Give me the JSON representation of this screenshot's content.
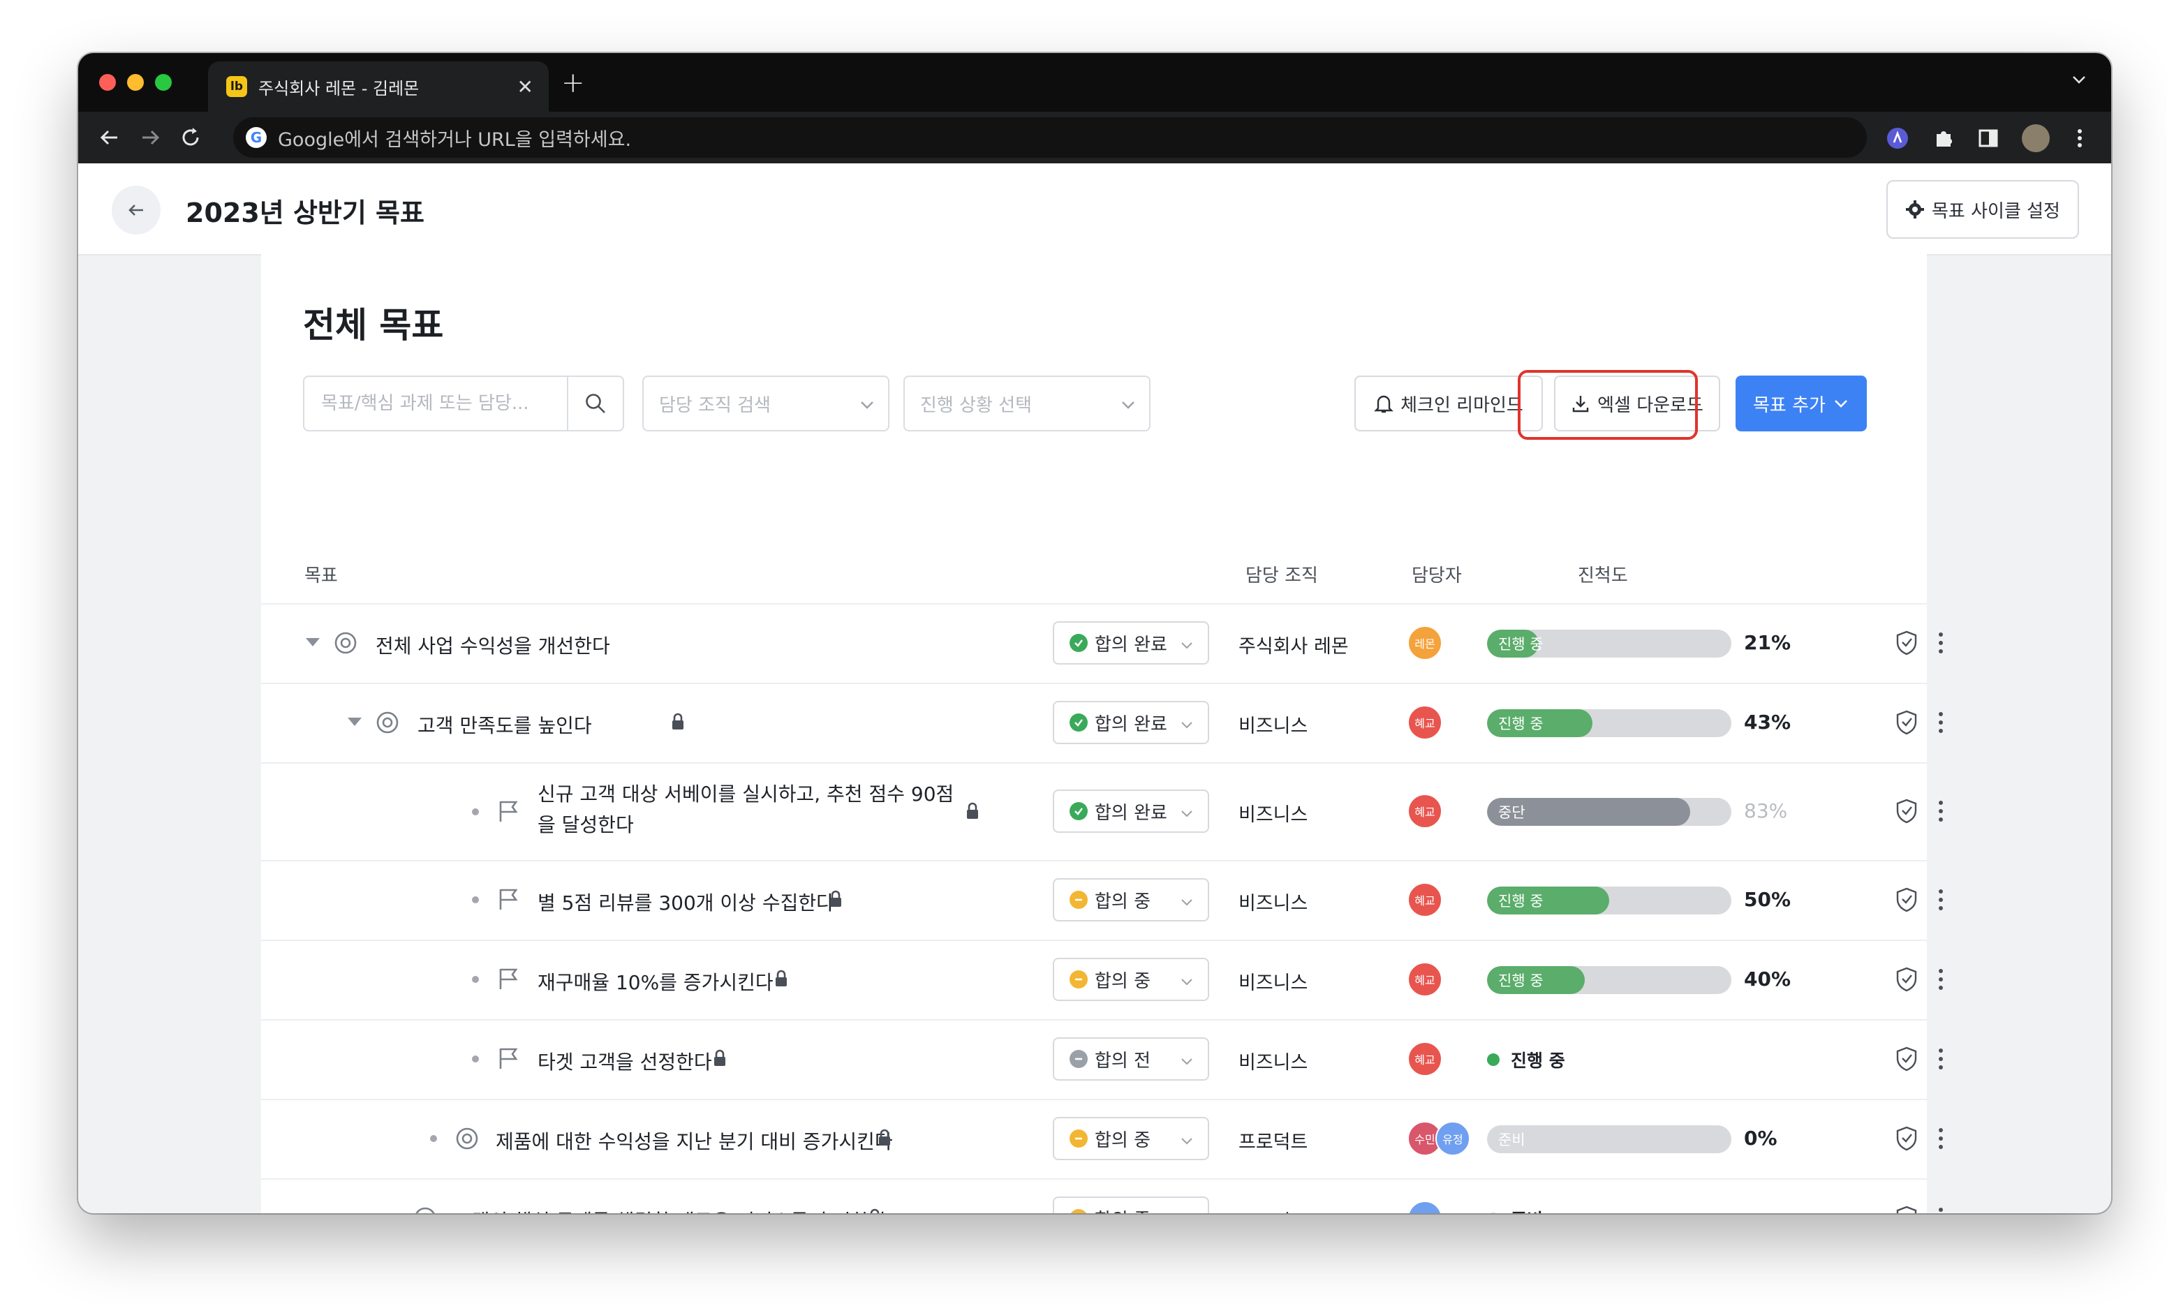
{
  "browser": {
    "tab_title": "주식회사 레몬 - 김레몬",
    "tab_favicon": "lb",
    "omnibox_placeholder": "Google에서 검색하거나 URL을 입력하세요."
  },
  "header": {
    "title": "2023년 상반기 목표",
    "cycle_button": "목표 사이클 설정"
  },
  "main": {
    "section_title": "전체 목표",
    "search_placeholder": "목표/핵심 과제 또는 담당...",
    "org_select_placeholder": "담당 조직 검색",
    "progress_select_placeholder": "진행 상황 선택",
    "remind_button": "체크인 리마인드",
    "excel_button": "엑셀 다운로드",
    "add_goal_button": "목표 추가"
  },
  "table": {
    "columns": [
      "목표",
      "담당 조직",
      "담당자",
      "진척도"
    ],
    "rows": [
      {
        "title": "전체 사업 수익성을 개선한다",
        "status": "합의 완료",
        "org": "주식회사 레몬",
        "avatars": [
          "레몬"
        ],
        "progress_label": "진행 중",
        "progress": 21,
        "pct": "21%"
      },
      {
        "title": "고객 만족도를 높인다",
        "status": "합의 완료",
        "org": "비즈니스",
        "avatars": [
          "혜교"
        ],
        "progress_label": "진행 중",
        "progress": 43,
        "pct": "43%"
      },
      {
        "title": "신규 고객 대상 서베이를 실시하고, 추천 점수 90점을 달성한다",
        "status": "합의 완료",
        "org": "비즈니스",
        "avatars": [
          "혜교"
        ],
        "progress_label": "중단",
        "progress": 83,
        "pct": "83%"
      },
      {
        "title": "별 5점 리뷰를 300개 이상 수집한다",
        "status": "합의 중",
        "org": "비즈니스",
        "avatars": [
          "혜교"
        ],
        "progress_label": "진행 중",
        "progress": 50,
        "pct": "50%"
      },
      {
        "title": "재구매율 10%를 증가시킨다",
        "status": "합의 중",
        "org": "비즈니스",
        "avatars": [
          "혜교"
        ],
        "progress_label": "진행 중",
        "progress": 40,
        "pct": "40%"
      },
      {
        "title": "타겟 고객을 선정한다",
        "status": "합의 전",
        "org": "비즈니스",
        "avatars": [
          "혜교"
        ],
        "progress_label": "진행 중"
      },
      {
        "title": "제품에 대한 수익성을 지난 분기 대비 증가시킨다",
        "status": "합의 중",
        "org": "프로덕트",
        "avatars": [
          "수민",
          "유정"
        ],
        "progress_label": "준비",
        "progress": 0,
        "pct": "0%"
      },
      {
        "title": "고객의 핵심 문제를 해결할 새로운 서비스를 출시한다",
        "status": "합의 중",
        "org": "프로덕트",
        "avatars": [
          "유정"
        ],
        "progress_label": "준비"
      }
    ]
  },
  "colors": {
    "accent": "#3d82f5",
    "in_progress": "#5aad6a",
    "stopped": "#8c9199",
    "agreed": "#3aaa5a",
    "agreeing": "#f2b632",
    "not_agreed": "#9aa0a8",
    "highlight": "#e0342c"
  }
}
